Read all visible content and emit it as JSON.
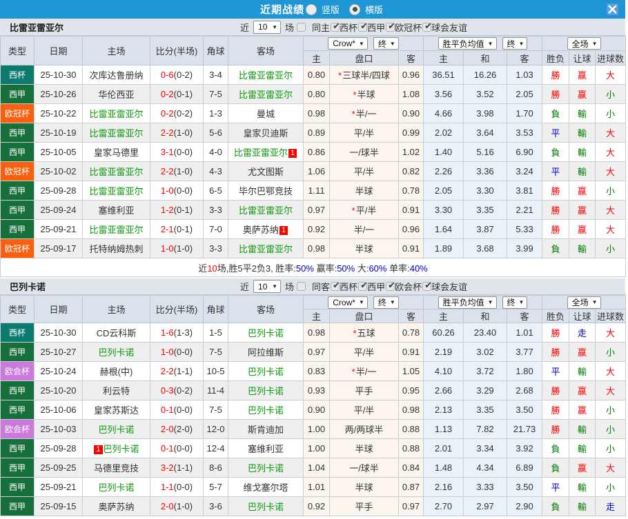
{
  "topbar": {
    "title": "近期战绩",
    "layout_options": [
      {
        "label": "竖版",
        "checked": false
      },
      {
        "label": "横版",
        "checked": true
      }
    ]
  },
  "table_head": {
    "static_cols": [
      "类型",
      "日期",
      "主场",
      "比分(半场)",
      "角球",
      "客场"
    ],
    "handicap_company_select": "Crow*",
    "handicap_final_select": "终",
    "handicap_cols": [
      "主",
      "盘口",
      "客"
    ],
    "wdl_select": "胜平负均值",
    "wdl_final_select": "终",
    "wdl_cols": [
      "主",
      "和",
      "客"
    ],
    "fulltime_select": "全场",
    "result_cols": [
      "胜负",
      "让球",
      "进球数"
    ]
  },
  "colors": {
    "topbar_blue": "#1e96d4",
    "league": {
      "西杯": "#0d7a70",
      "西甲": "#17703b",
      "欧冠杯": "#f8600f",
      "欧会杯": "#cb79db"
    },
    "outcome": {
      "勝": "red",
      "負": "green",
      "平": "blue",
      "赢": "red",
      "輸": "green",
      "走": "blue",
      "大": "red",
      "小": "green"
    },
    "team_green": "#099909",
    "score_red": "#ff0000",
    "handicap_band": "#fbf5ee",
    "average_band": "#e9f2f9"
  },
  "sections": [
    {
      "team": "比雷亚雷亚尔",
      "controls": {
        "near_label": "近",
        "count": "10",
        "games_label": "场",
        "filters": [
          {
            "label": "同主",
            "checked": false
          },
          {
            "label": "西杯",
            "checked": true
          },
          {
            "label": "西甲",
            "checked": true
          },
          {
            "label": "欧冠杯",
            "checked": true
          },
          {
            "label": "球会友谊",
            "checked": true
          }
        ]
      },
      "rows": [
        {
          "league": "西杯",
          "date": "25-10-30",
          "home": "次库达鲁册纳",
          "home_green": false,
          "score": "0-6",
          "half": "(0-2)",
          "corners": "3-4",
          "away": "比雷亚雷亚尔",
          "away_green": true,
          "odds_home": "0.80",
          "handicap_star": true,
          "handicap": "三球半/四球",
          "odds_away": "0.96",
          "avg_home": "36.51",
          "avg_draw": "16.26",
          "avg_away": "1.03",
          "outcome": "勝",
          "handicap_outcome": "赢",
          "goals_outcome": "大"
        },
        {
          "league": "西甲",
          "date": "25-10-26",
          "home": "华伦西亚",
          "home_green": false,
          "score": "0-2",
          "half": "(0-1)",
          "corners": "7-5",
          "away": "比雷亚雷亚尔",
          "away_green": true,
          "odds_home": "0.80",
          "handicap_star": true,
          "handicap": "半球",
          "odds_away": "1.08",
          "avg_home": "3.56",
          "avg_draw": "3.52",
          "avg_away": "2.05",
          "outcome": "勝",
          "handicap_outcome": "赢",
          "goals_outcome": "小"
        },
        {
          "league": "欧冠杯",
          "date": "25-10-22",
          "home": "比雷亚雷亚尔",
          "home_green": true,
          "score": "0-2",
          "half": "(0-2)",
          "corners": "1-3",
          "away": "曼城",
          "away_green": false,
          "odds_home": "0.98",
          "handicap_star": true,
          "handicap": "半/一",
          "odds_away": "0.90",
          "avg_home": "4.66",
          "avg_draw": "3.98",
          "avg_away": "1.70",
          "outcome": "負",
          "handicap_outcome": "輸",
          "goals_outcome": "小"
        },
        {
          "league": "西甲",
          "date": "25-10-19",
          "home": "比雷亚雷亚尔",
          "home_green": true,
          "score": "2-2",
          "half": "(1-0)",
          "corners": "5-6",
          "away": "皇家贝迪斯",
          "away_green": false,
          "odds_home": "0.89",
          "handicap_star": false,
          "handicap": "平/半",
          "odds_away": "0.99",
          "avg_home": "2.02",
          "avg_draw": "3.64",
          "avg_away": "3.53",
          "outcome": "平",
          "handicap_outcome": "輸",
          "goals_outcome": "大"
        },
        {
          "league": "西甲",
          "date": "25-10-05",
          "home": "皇家马德里",
          "home_green": false,
          "score": "3-1",
          "half": "(0-0)",
          "corners": "4-0",
          "away": "比雷亚雷亚尔",
          "away_green": true,
          "away_badge": "1",
          "odds_home": "0.86",
          "handicap_star": false,
          "handicap": "一/球半",
          "odds_away": "1.02",
          "avg_home": "1.40",
          "avg_draw": "5.16",
          "avg_away": "6.90",
          "outcome": "負",
          "handicap_outcome": "輸",
          "goals_outcome": "大"
        },
        {
          "league": "欧冠杯",
          "date": "25-10-02",
          "home": "比雷亚雷亚尔",
          "home_green": true,
          "score": "2-2",
          "half": "(1-0)",
          "corners": "4-3",
          "away": "尤文图斯",
          "away_green": false,
          "odds_home": "1.06",
          "handicap_star": false,
          "handicap": "平/半",
          "odds_away": "0.82",
          "avg_home": "2.26",
          "avg_draw": "3.36",
          "avg_away": "3.24",
          "outcome": "平",
          "handicap_outcome": "輸",
          "goals_outcome": "大"
        },
        {
          "league": "西甲",
          "date": "25-09-28",
          "home": "比雷亚雷亚尔",
          "home_green": true,
          "score": "1-0",
          "half": "(0-0)",
          "corners": "6-5",
          "away": "毕尔巴鄂竞技",
          "away_green": false,
          "odds_home": "1.11",
          "handicap_star": false,
          "handicap": "半球",
          "odds_away": "0.78",
          "avg_home": "2.05",
          "avg_draw": "3.30",
          "avg_away": "3.81",
          "outcome": "勝",
          "handicap_outcome": "赢",
          "goals_outcome": "小"
        },
        {
          "league": "西甲",
          "date": "25-09-24",
          "home": "塞维利亚",
          "home_green": false,
          "score": "1-2",
          "half": "(0-1)",
          "corners": "3-3",
          "away": "比雷亚雷亚尔",
          "away_green": true,
          "odds_home": "0.97",
          "handicap_star": true,
          "handicap": "平/半",
          "odds_away": "0.91",
          "avg_home": "3.30",
          "avg_draw": "3.35",
          "avg_away": "2.21",
          "outcome": "勝",
          "handicap_outcome": "赢",
          "goals_outcome": "大"
        },
        {
          "league": "西甲",
          "date": "25-09-21",
          "home": "比雷亚雷亚尔",
          "home_green": true,
          "score": "2-1",
          "half": "(0-1)",
          "corners": "7-0",
          "away": "奥萨苏纳",
          "away_green": false,
          "away_badge": "1",
          "odds_home": "0.92",
          "handicap_star": false,
          "handicap": "半/一",
          "odds_away": "0.96",
          "avg_home": "1.64",
          "avg_draw": "3.87",
          "avg_away": "5.33",
          "outcome": "勝",
          "handicap_outcome": "赢",
          "goals_outcome": "大"
        },
        {
          "league": "欧冠杯",
          "date": "25-09-17",
          "home": "托特纳姆热刺",
          "home_green": false,
          "score": "1-0",
          "half": "(1-0)",
          "corners": "3-3",
          "away": "比雷亚雷亚尔",
          "away_green": true,
          "odds_home": "0.98",
          "handicap_star": false,
          "handicap": "半球",
          "odds_away": "0.91",
          "avg_home": "1.89",
          "avg_draw": "3.68",
          "avg_away": "3.99",
          "outcome": "負",
          "handicap_outcome": "輸",
          "goals_outcome": "小"
        }
      ],
      "summary_parts": [
        {
          "t": "近"
        },
        {
          "t": "10",
          "c": "red"
        },
        {
          "t": "场,胜5平2负3, 胜率:"
        },
        {
          "t": "50%",
          "c": "blue"
        },
        {
          "t": " 赢率:"
        },
        {
          "t": "50%",
          "c": "blue"
        },
        {
          "t": " 大:"
        },
        {
          "t": "60%",
          "c": "blue"
        },
        {
          "t": " 单率:"
        },
        {
          "t": "40%",
          "c": "blue"
        }
      ]
    },
    {
      "team": "巴列卡诺",
      "controls": {
        "near_label": "近",
        "count": "10",
        "games_label": "场",
        "filters": [
          {
            "label": "同客",
            "checked": false
          },
          {
            "label": "西杯",
            "checked": true
          },
          {
            "label": "西甲",
            "checked": true
          },
          {
            "label": "欧会杯",
            "checked": true
          },
          {
            "label": "球会友谊",
            "checked": true
          }
        ]
      },
      "rows": [
        {
          "league": "西杯",
          "date": "25-10-30",
          "home": "CD云科斯",
          "home_green": false,
          "score": "1-6",
          "half": "(1-3)",
          "corners": "1-5",
          "away": "巴列卡诺",
          "away_green": true,
          "odds_home": "0.98",
          "handicap_star": true,
          "handicap": "五球",
          "odds_away": "0.78",
          "avg_home": "60.26",
          "avg_draw": "23.40",
          "avg_away": "1.01",
          "outcome": "勝",
          "handicap_outcome": "走",
          "goals_outcome": "大"
        },
        {
          "league": "西甲",
          "date": "25-10-27",
          "home": "巴列卡诺",
          "home_green": true,
          "score": "1-0",
          "half": "(0-0)",
          "corners": "7-5",
          "away": "阿拉维斯",
          "away_green": false,
          "odds_home": "0.97",
          "handicap_star": false,
          "handicap": "平/半",
          "odds_away": "0.91",
          "avg_home": "2.19",
          "avg_draw": "3.02",
          "avg_away": "3.77",
          "outcome": "勝",
          "handicap_outcome": "赢",
          "goals_outcome": "小"
        },
        {
          "league": "欧会杯",
          "date": "25-10-24",
          "home": "赫根(中)",
          "home_green": false,
          "score": "2-2",
          "half": "(1-1)",
          "corners": "10-5",
          "away": "巴列卡诺",
          "away_green": true,
          "odds_home": "0.83",
          "handicap_star": true,
          "handicap": "半/一",
          "odds_away": "1.05",
          "avg_home": "4.10",
          "avg_draw": "3.72",
          "avg_away": "1.80",
          "outcome": "平",
          "handicap_outcome": "輸",
          "goals_outcome": "大"
        },
        {
          "league": "西甲",
          "date": "25-10-20",
          "home": "利云特",
          "home_green": false,
          "score": "0-3",
          "half": "(0-2)",
          "corners": "11-4",
          "away": "巴列卡诺",
          "away_green": true,
          "odds_home": "0.93",
          "handicap_star": false,
          "handicap": "平手",
          "odds_away": "0.95",
          "avg_home": "2.66",
          "avg_draw": "3.29",
          "avg_away": "2.68",
          "outcome": "勝",
          "handicap_outcome": "赢",
          "goals_outcome": "大"
        },
        {
          "league": "西甲",
          "date": "25-10-06",
          "home": "皇家苏斯达",
          "home_green": false,
          "score": "0-1",
          "half": "(0-0)",
          "corners": "7-5",
          "away": "巴列卡诺",
          "away_green": true,
          "odds_home": "0.90",
          "handicap_star": false,
          "handicap": "平/半",
          "odds_away": "0.98",
          "avg_home": "2.13",
          "avg_draw": "3.35",
          "avg_away": "3.50",
          "outcome": "勝",
          "handicap_outcome": "赢",
          "goals_outcome": "小"
        },
        {
          "league": "欧会杯",
          "date": "25-10-03",
          "home": "巴列卡诺",
          "home_green": true,
          "score": "2-0",
          "half": "(2-0)",
          "corners": "12-0",
          "away": "斯肯迪加",
          "away_green": false,
          "odds_home": "1.00",
          "handicap_star": false,
          "handicap": "两/两球半",
          "odds_away": "0.88",
          "avg_home": "1.13",
          "avg_draw": "7.82",
          "avg_away": "21.73",
          "outcome": "勝",
          "handicap_outcome": "輸",
          "goals_outcome": "小"
        },
        {
          "league": "西甲",
          "date": "25-09-28",
          "home": "巴列卡诺",
          "home_green": true,
          "home_badge": "1",
          "home_badge_pos": "before",
          "score": "0-1",
          "half": "(0-0)",
          "corners": "12-4",
          "away": "塞维利亚",
          "away_green": false,
          "odds_home": "1.00",
          "handicap_star": false,
          "handicap": "半球",
          "odds_away": "0.88",
          "avg_home": "2.01",
          "avg_draw": "3.34",
          "avg_away": "3.92",
          "outcome": "負",
          "handicap_outcome": "輸",
          "goals_outcome": "小"
        },
        {
          "league": "西甲",
          "date": "25-09-25",
          "home": "马德里竞技",
          "home_green": false,
          "score": "3-2",
          "half": "(1-1)",
          "corners": "8-6",
          "away": "巴列卡诺",
          "away_green": true,
          "odds_home": "1.04",
          "handicap_star": false,
          "handicap": "一/球半",
          "odds_away": "0.84",
          "avg_home": "1.48",
          "avg_draw": "4.34",
          "avg_away": "6.89",
          "outcome": "負",
          "handicap_outcome": "赢",
          "goals_outcome": "大"
        },
        {
          "league": "西甲",
          "date": "25-09-21",
          "home": "巴列卡诺",
          "home_green": true,
          "score": "1-1",
          "half": "(0-0)",
          "corners": "5-7",
          "away": "维戈塞尔塔",
          "away_green": false,
          "odds_home": "1.01",
          "handicap_star": false,
          "handicap": "半球",
          "odds_away": "0.87",
          "avg_home": "2.16",
          "avg_draw": "3.33",
          "avg_away": "3.50",
          "outcome": "平",
          "handicap_outcome": "輸",
          "goals_outcome": "小"
        },
        {
          "league": "西甲",
          "date": "25-09-15",
          "home": "奥萨苏纳",
          "home_green": false,
          "score": "2-0",
          "half": "(1-0)",
          "corners": "3-6",
          "away": "巴列卡诺",
          "away_green": true,
          "odds_home": "0.92",
          "handicap_star": false,
          "handicap": "平手",
          "odds_away": "0.97",
          "avg_home": "2.70",
          "avg_draw": "2.97",
          "avg_away": "2.90",
          "outcome": "負",
          "handicap_outcome": "輸",
          "goals_outcome": "走"
        }
      ]
    }
  ]
}
